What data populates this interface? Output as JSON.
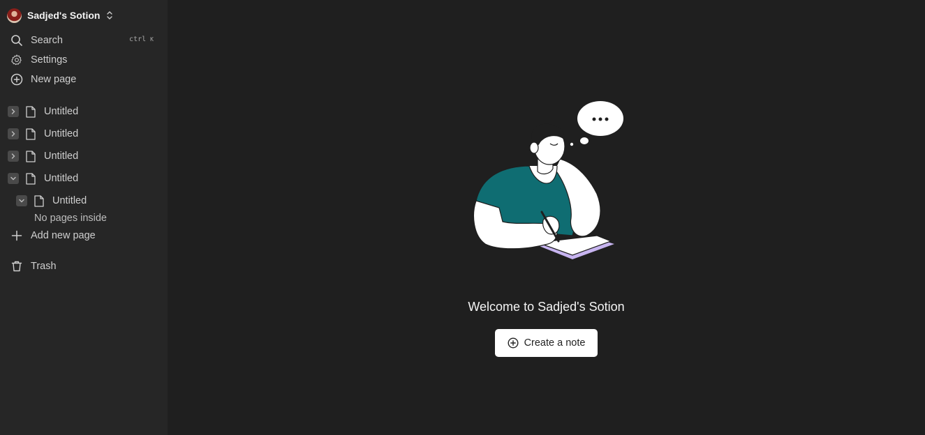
{
  "sidebar": {
    "workspace_name": "Sadjed's Sotion",
    "search": {
      "label": "Search",
      "shortcut_ctrl": "ctrl",
      "shortcut_key": "K"
    },
    "settings_label": "Settings",
    "new_page_label": "New page",
    "pages": [
      {
        "label": "Untitled",
        "expanded": false
      },
      {
        "label": "Untitled",
        "expanded": false
      },
      {
        "label": "Untitled",
        "expanded": false
      },
      {
        "label": "Untitled",
        "expanded": true,
        "children": [
          {
            "label": "Untitled",
            "expanded": true,
            "children_empty_label": "No pages inside"
          }
        ]
      }
    ],
    "add_new_page_label": "Add new page",
    "trash_label": "Trash"
  },
  "main": {
    "welcome_title": "Welcome to Sadjed's Sotion",
    "create_button_label": "Create a note"
  },
  "colors": {
    "accent_teal": "#0f6d72",
    "paper_lilac": "#c7b4f0"
  }
}
